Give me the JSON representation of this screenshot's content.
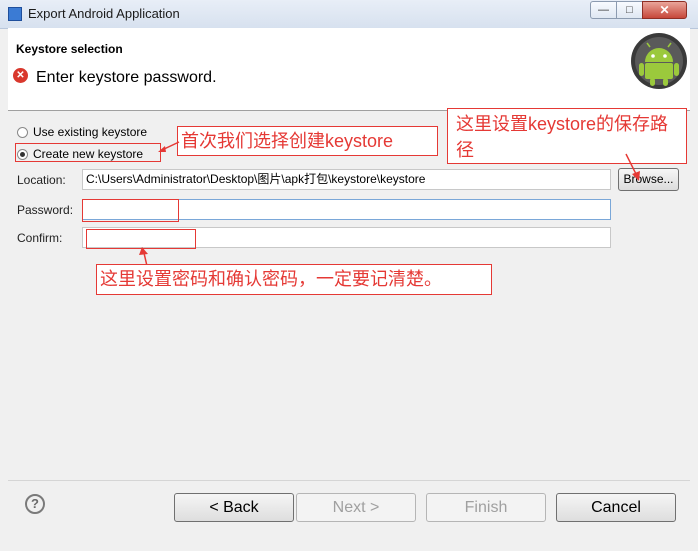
{
  "window": {
    "title": "Export Android Application",
    "min_glyph": "—",
    "max_glyph": "□",
    "close_glyph": "✕"
  },
  "header": {
    "title": "Keystore selection",
    "message": "Enter keystore password.",
    "error_glyph": "✕"
  },
  "options": {
    "use_existing": "Use existing keystore",
    "create_new": "Create new keystore",
    "selected": "create_new"
  },
  "form": {
    "location_label": "Location:",
    "location_value": "C:\\Users\\Administrator\\Desktop\\图片\\apk打包\\keystore\\keystore",
    "browse_label": "Browse...",
    "password_label": "Password:",
    "password_value": "",
    "confirm_label": "Confirm:",
    "confirm_value": ""
  },
  "annotations": {
    "first_time": "首次我们选择创建keystore",
    "save_path": "这里设置keystore的保存路径",
    "password_note": "这里设置密码和确认密码，一定要记清楚。",
    "color": "#e53935"
  },
  "footer": {
    "help_glyph": "?",
    "back": "< Back",
    "next": "Next >",
    "finish": "Finish",
    "cancel": "Cancel"
  }
}
